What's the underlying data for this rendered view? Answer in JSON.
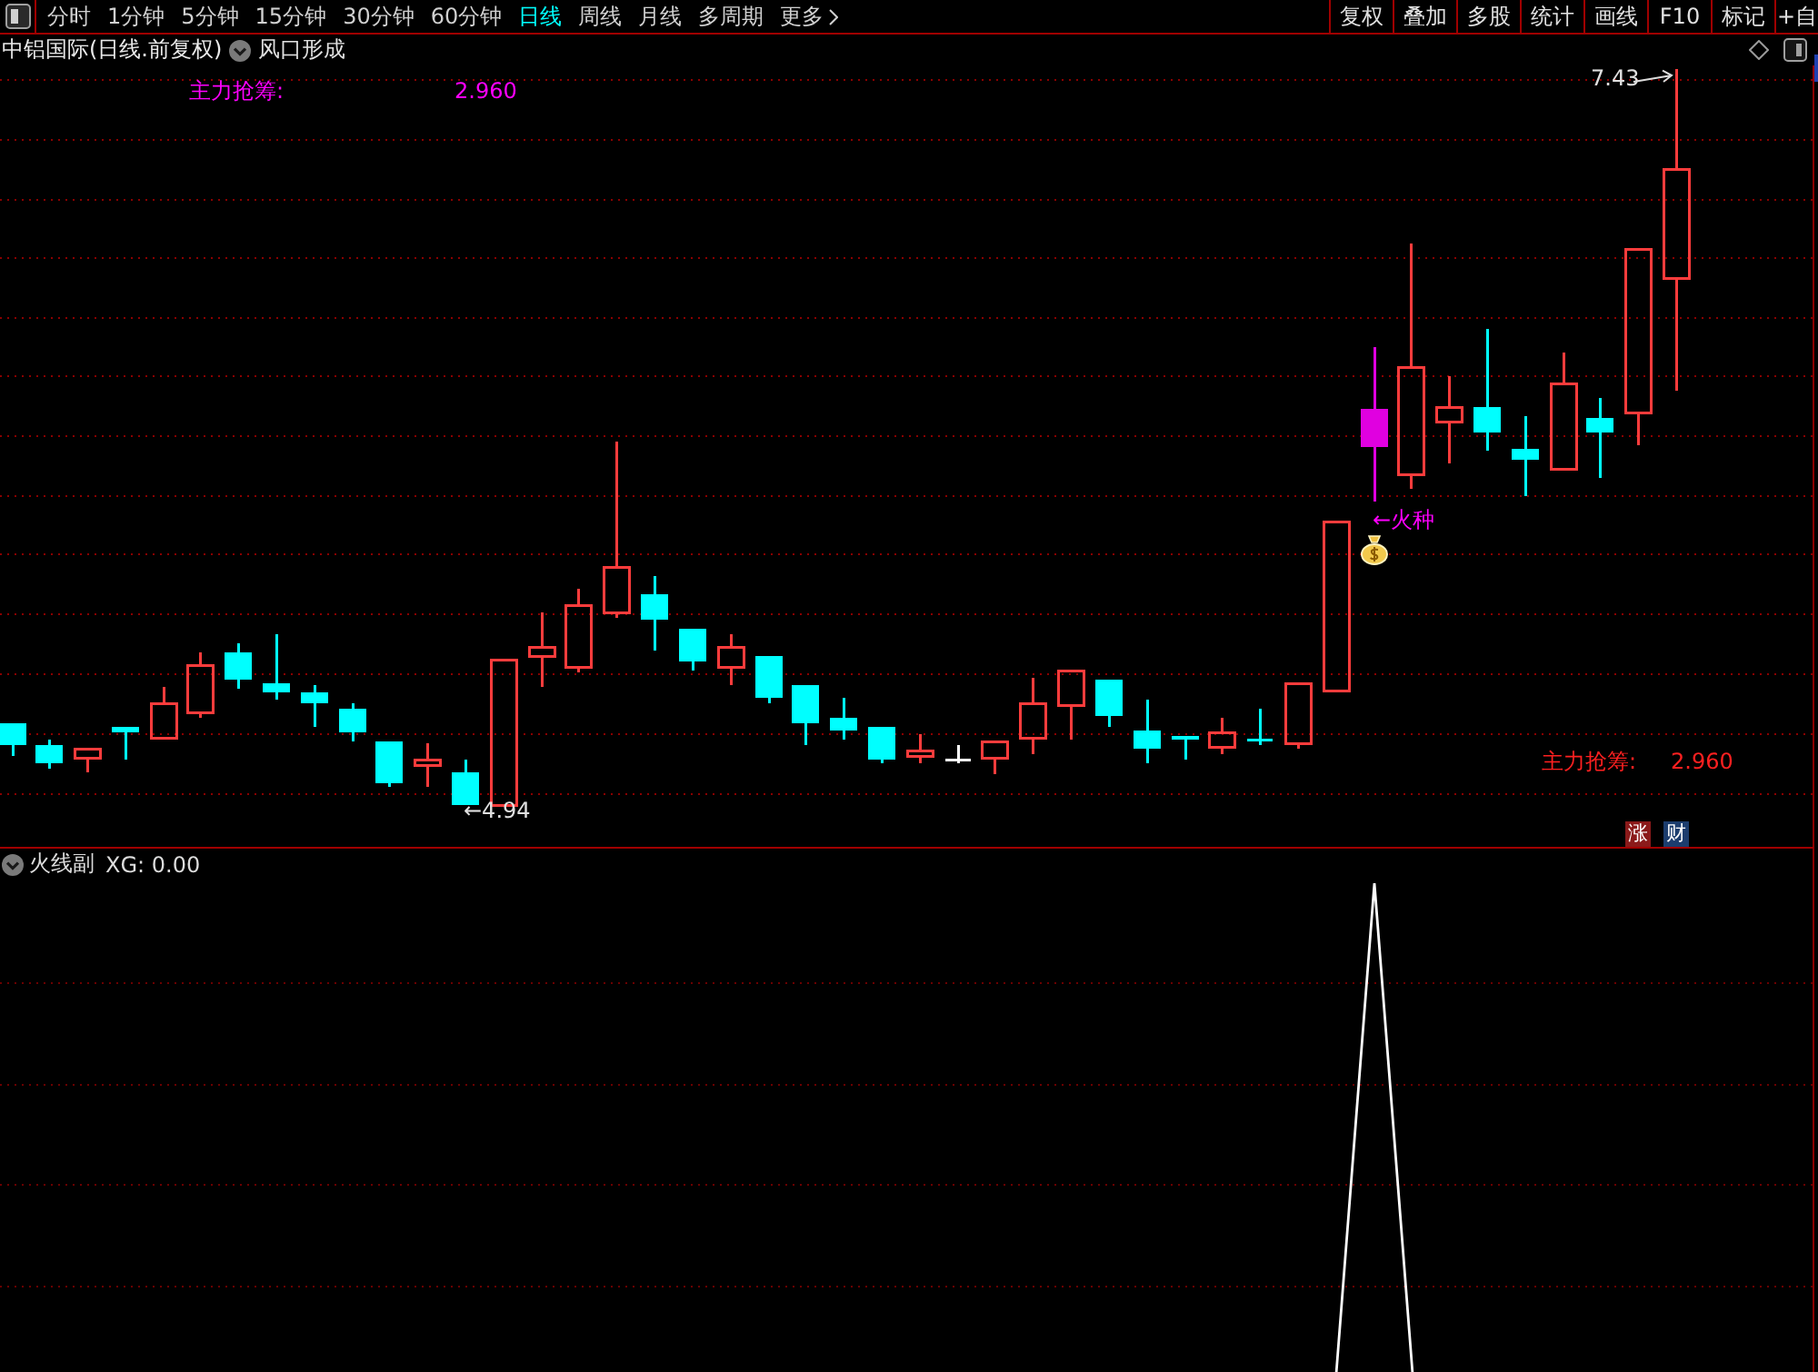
{
  "toolbar": {
    "periods": [
      {
        "label": "分时",
        "selected": false
      },
      {
        "label": "1分钟",
        "selected": false
      },
      {
        "label": "5分钟",
        "selected": false
      },
      {
        "label": "15分钟",
        "selected": false
      },
      {
        "label": "30分钟",
        "selected": false
      },
      {
        "label": "60分钟",
        "selected": false
      },
      {
        "label": "日线",
        "selected": true
      },
      {
        "label": "周线",
        "selected": false
      },
      {
        "label": "月线",
        "selected": false
      },
      {
        "label": "多周期",
        "selected": false
      }
    ],
    "more": "更多",
    "tools": [
      "复权",
      "叠加",
      "多股",
      "统计",
      "画线",
      "F10",
      "标记",
      "+自"
    ]
  },
  "chart_header": {
    "title": "中铝国际(日线.前复权)",
    "formula": "风口形成"
  },
  "main_panel": {
    "indicator": {
      "label": "主力抢筹:",
      "value": "2.960"
    },
    "high_marker": "7.43",
    "low_marker": "←4.94",
    "signal_marker": "←火种",
    "footer_indicator": {
      "label": "主力抢筹:",
      "value": "2.960"
    },
    "badges": [
      {
        "text": "涨",
        "color": "#8b1a1a"
      },
      {
        "text": "财",
        "color": "#1c3d6e"
      }
    ]
  },
  "sub_panel": {
    "title": "火线副",
    "reading": "XG: 0.00"
  }
}
